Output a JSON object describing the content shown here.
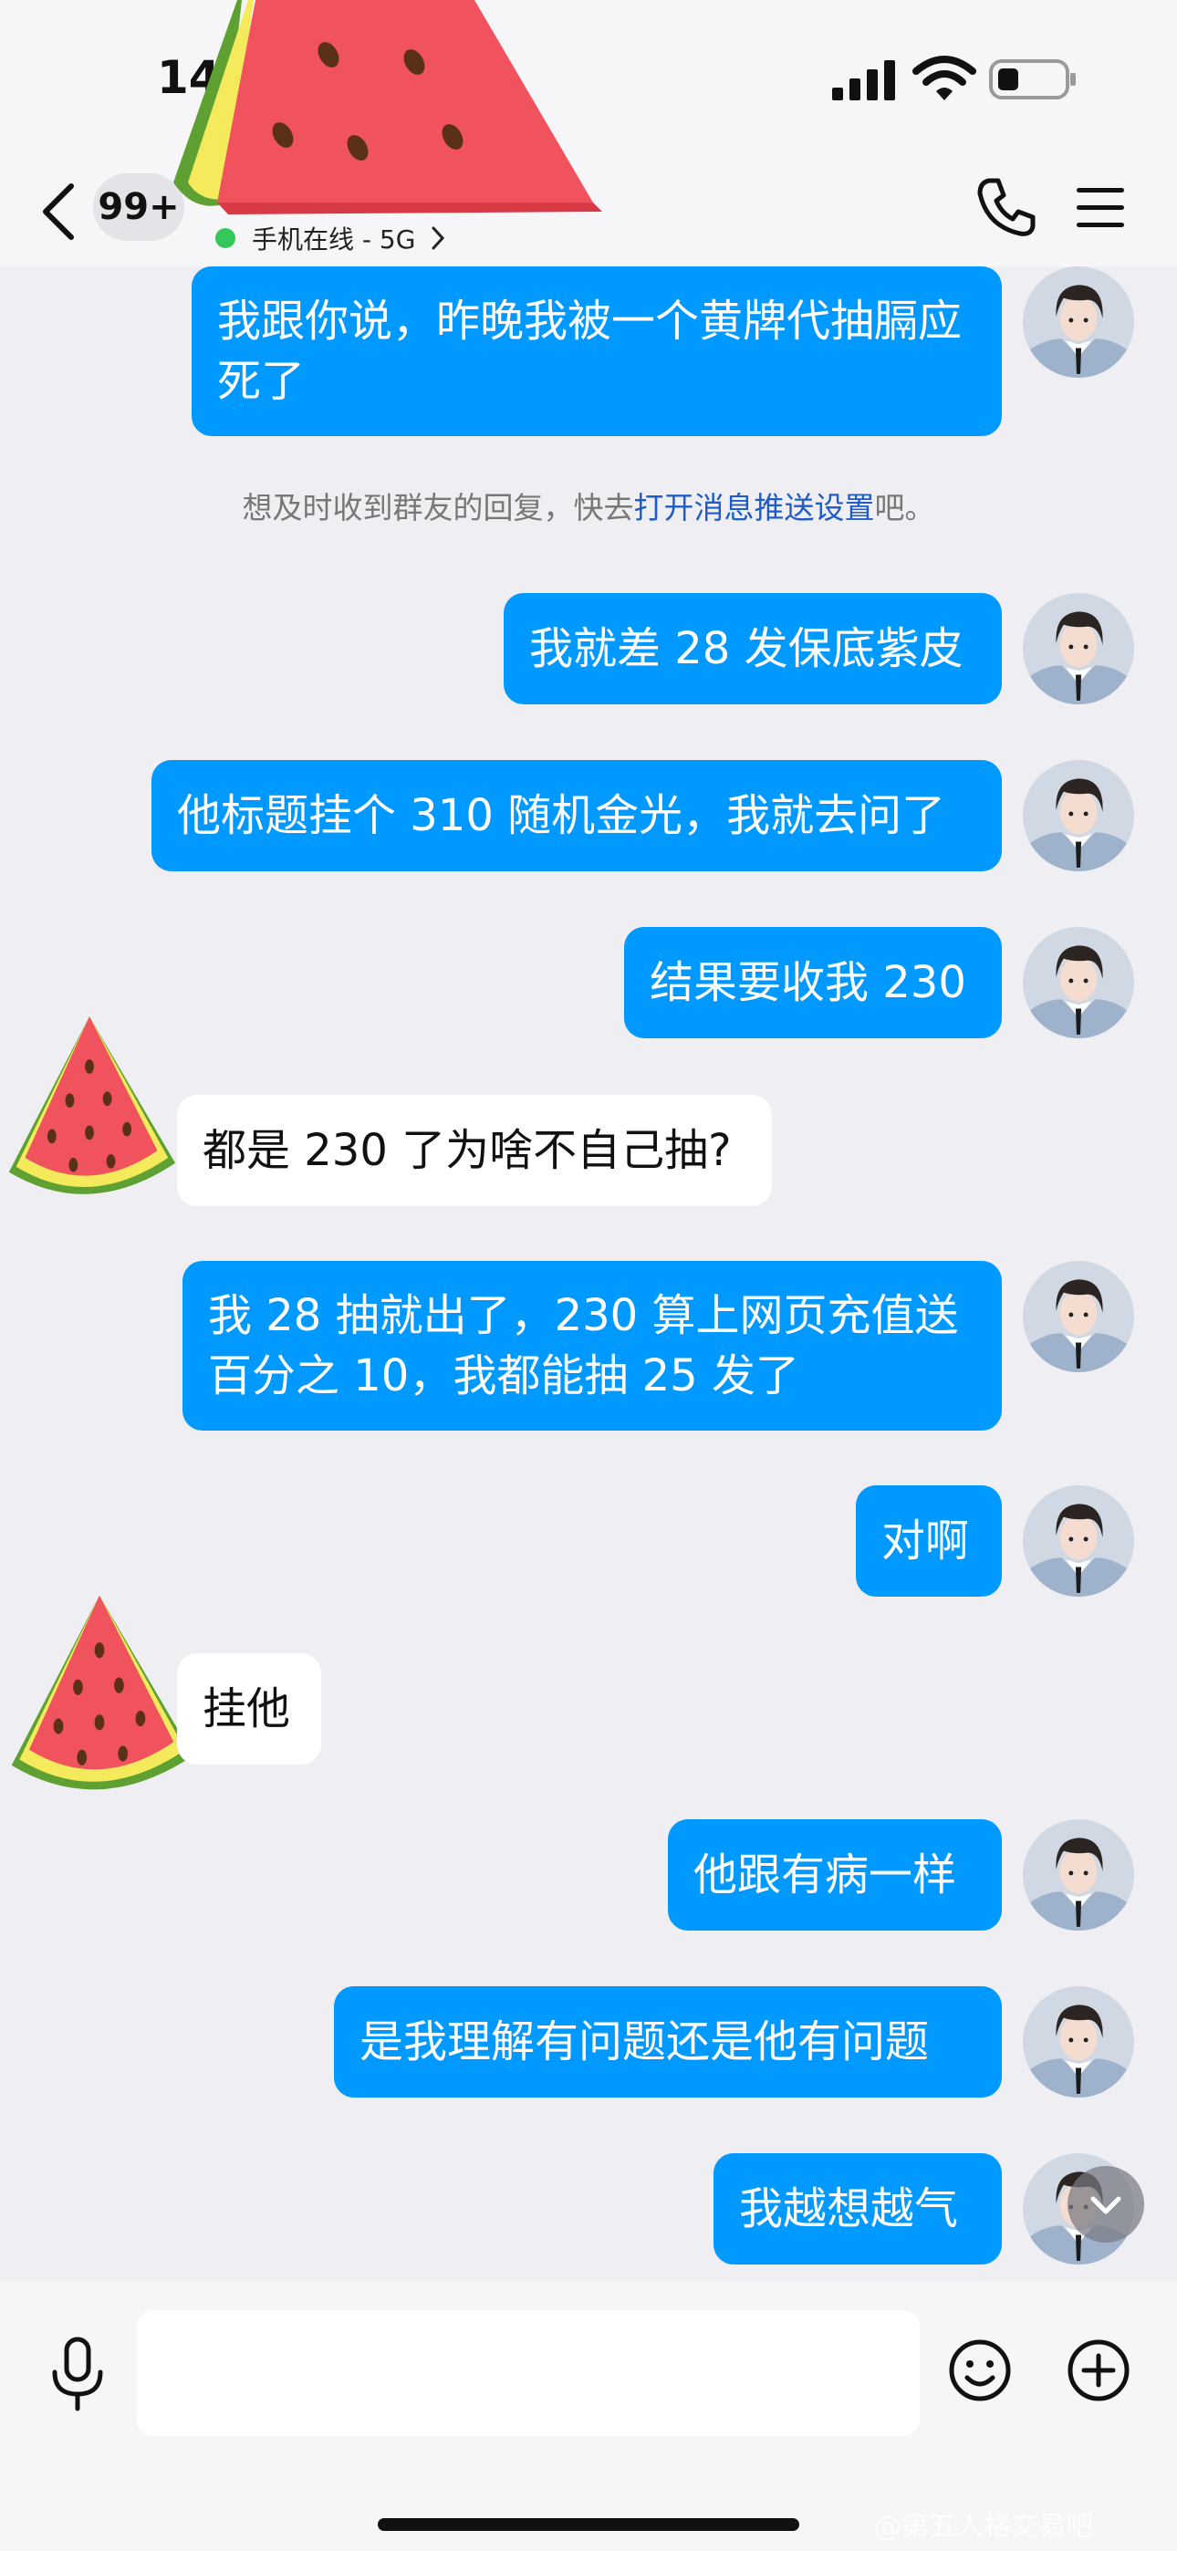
{
  "status_bar": {
    "time": "14"
  },
  "header": {
    "unread_count": "99+",
    "online_status": "手机在线 - 5G",
    "back_icon": "chevron-left-icon",
    "call_icon": "phone-icon",
    "menu_icon": "hamburger-menu-icon"
  },
  "notice": {
    "prefix": "想及时收到群友的回复，快去",
    "link": "打开消息推送设置",
    "suffix": "吧。"
  },
  "messages": [
    {
      "side": "out",
      "text": "我跟你说，昨晚我被一个黄牌代抽膈应死了"
    },
    {
      "side": "out",
      "text": "我就差 28 发保底紫皮"
    },
    {
      "side": "out",
      "text": "他标题挂个 310 随机金光，我就去问了"
    },
    {
      "side": "out",
      "text": "结果要收我 230"
    },
    {
      "side": "in",
      "text": "都是 230 了为啥不自己抽?"
    },
    {
      "side": "out",
      "text": "我 28 抽就出了，230 算上网页充值送百分之 10，我都能抽 25 发了"
    },
    {
      "side": "out",
      "text": "对啊"
    },
    {
      "side": "in",
      "text": "挂他"
    },
    {
      "side": "out",
      "text": "他跟有病一样"
    },
    {
      "side": "out",
      "text": "是我理解有问题还是他有问题"
    },
    {
      "side": "out",
      "text": "我越想越气"
    }
  ],
  "input_bar": {
    "placeholder": "",
    "mic_icon": "microphone-icon",
    "emoji_icon": "smiley-icon",
    "plus_icon": "plus-circle-icon"
  },
  "watermark": "@第五人格交易吧",
  "colors": {
    "outgoing_bubble": "#0099ff",
    "incoming_bubble": "#ffffff",
    "background": "#efeff3",
    "online_dot": "#34c759",
    "link": "#1f5cc7"
  }
}
